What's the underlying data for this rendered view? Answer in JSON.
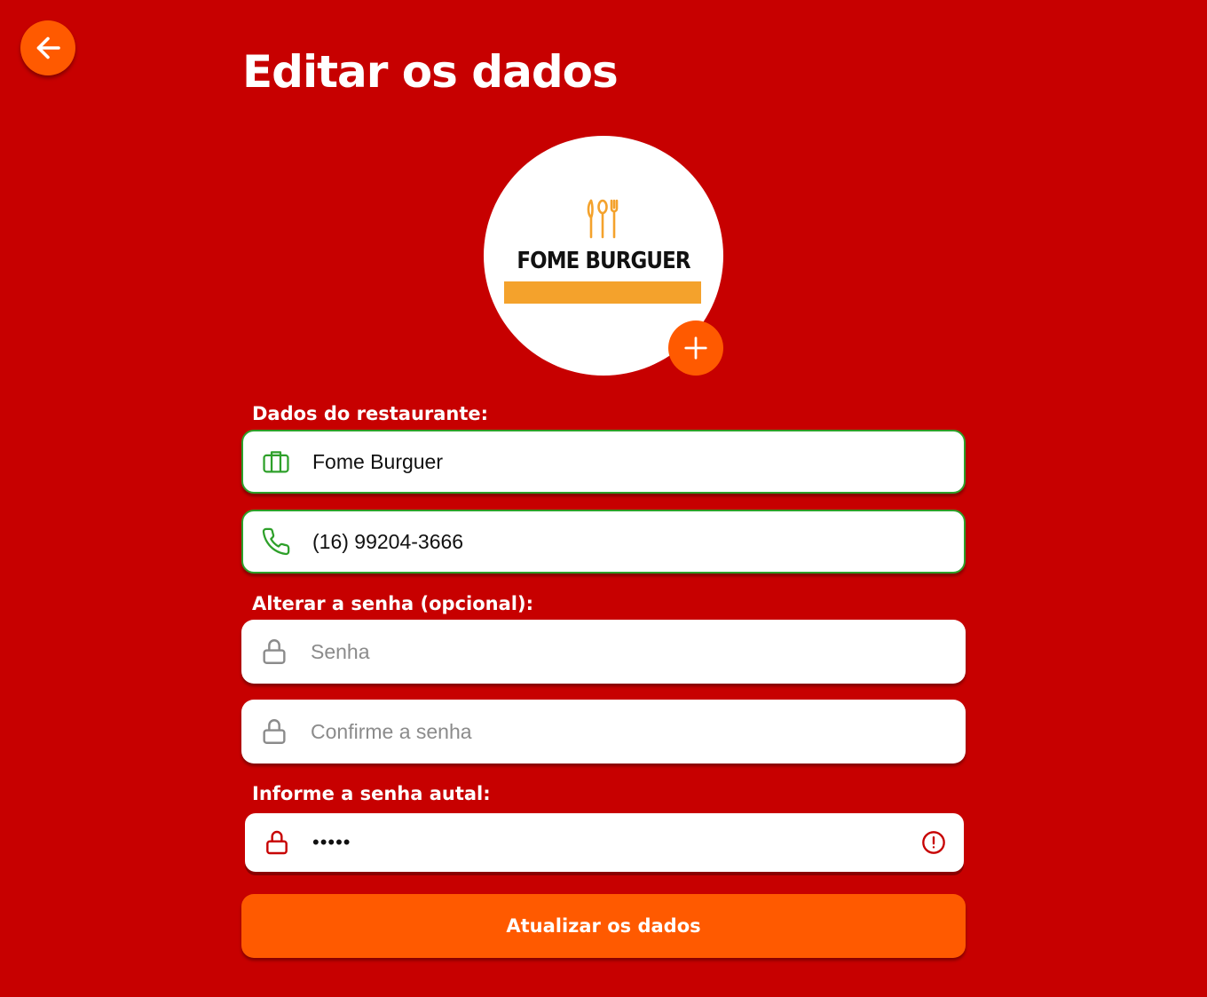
{
  "page": {
    "title": "Editar os dados"
  },
  "logo": {
    "text": "FOME BURGUER",
    "bar_color": "#f4a22c"
  },
  "sections": {
    "restaurant": "Dados do restaurante:",
    "change_password": "Alterar a senha (opcional):",
    "current_password": "Informe a senha autal:"
  },
  "fields": {
    "name": {
      "value": "Fome Burguer",
      "icon": "briefcase-icon"
    },
    "phone": {
      "value": "(16) 99204-3666",
      "icon": "phone-icon"
    },
    "password": {
      "placeholder": "Senha",
      "icon": "lock-icon"
    },
    "confirm_password": {
      "placeholder": "Confirme a senha",
      "icon": "lock-icon"
    },
    "current_password": {
      "value": "•••••",
      "icon": "lock-icon",
      "status_icon": "alert-circle-icon"
    }
  },
  "buttons": {
    "back": "arrow-left-icon",
    "add_photo": "plus-icon",
    "submit": "Atualizar os dados"
  },
  "colors": {
    "background": "#c70000",
    "accent": "#ff5a00",
    "valid": "#2ea02a",
    "error": "#c70000"
  }
}
